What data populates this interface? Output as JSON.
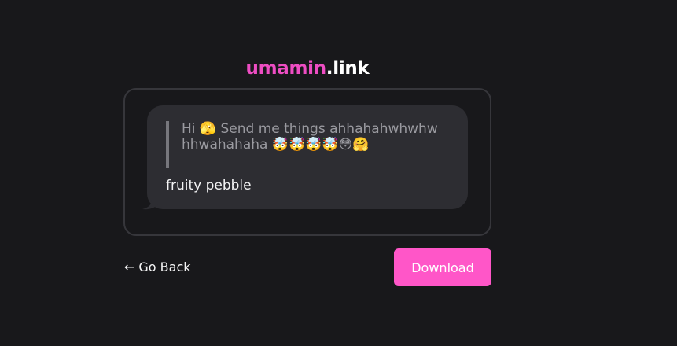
{
  "logo": {
    "brand": "umamin",
    "tld": ".link"
  },
  "message": {
    "prompt": "Hi 🫣 Send me things ahhahahwhwhwhhwahahaha 🤯🤯🤯🤯😳🤗",
    "reply": "fruity pebble"
  },
  "actions": {
    "back_arrow": "←",
    "back_label": "Go Back",
    "download_label": "Download"
  },
  "colors": {
    "background": "#18181b",
    "brand_pink": "#ee4dc3",
    "button_pink": "#ff56c8",
    "bubble": "#2d2d32",
    "card_border": "#36363b"
  }
}
